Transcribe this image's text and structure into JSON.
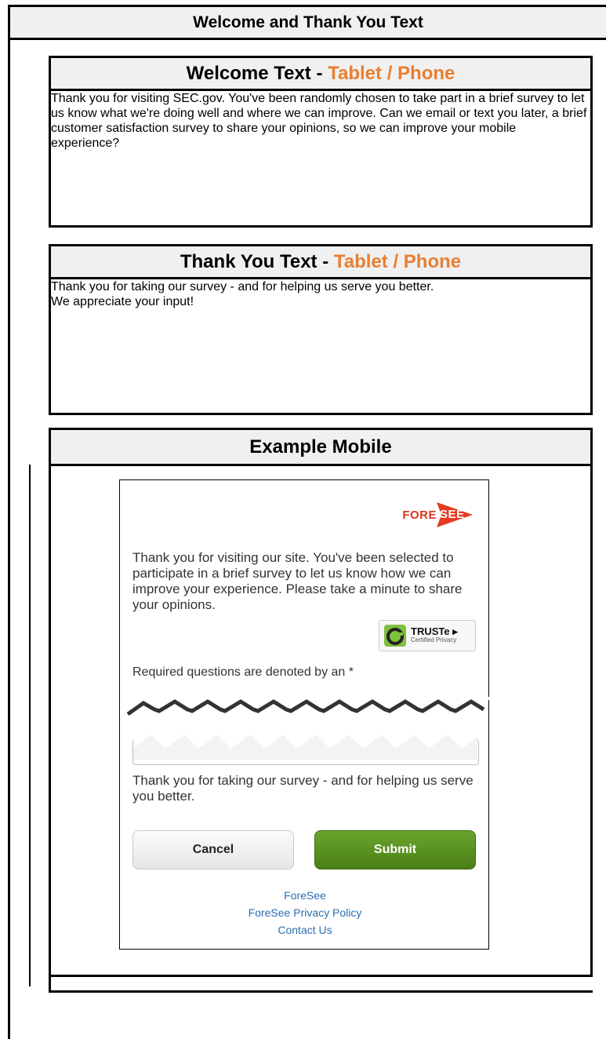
{
  "main_header": {
    "title": "Welcome and Thank You Text"
  },
  "welcome_section": {
    "title": "Welcome Text - ",
    "title_accent": "Tablet / Phone",
    "body": "Thank you for visiting SEC.gov. You've been randomly chosen to take part in a brief survey to let us know what we're doing well and where we can improve. Can we email or text you later, a brief customer satisfaction survey to share your opinions, so we can improve your mobile experience?"
  },
  "thankyou_section": {
    "title": "Thank You Text - ",
    "title_accent": "Tablet / Phone",
    "body_line1": "Thank you for taking our survey - and for helping us serve you better.",
    "body_line2": "We appreciate your input!"
  },
  "example_section": {
    "title": "Example Mobile"
  },
  "mobile_example": {
    "logo_text_left": "FORE",
    "logo_text_right": "SEE",
    "intro": "Thank you for visiting our site. You've been selected to participate in a brief survey to let us know how we can improve your experience. Please take a minute to share your opinions.",
    "truste_big": "TRUSTe",
    "truste_small": "Certified Privacy",
    "required_note": "Required questions are denoted by an *",
    "thanks": "Thank you for taking our survey - and for helping us serve you better.",
    "cancel_label": "Cancel",
    "submit_label": "Submit",
    "links": [
      "ForeSee",
      "ForeSee Privacy Policy",
      "Contact Us"
    ]
  },
  "colors": {
    "accent_orange": "#e87f32",
    "submit_green": "#4a7f16",
    "link_blue": "#2a6fb0",
    "header_gray": "#f0f0f0"
  }
}
